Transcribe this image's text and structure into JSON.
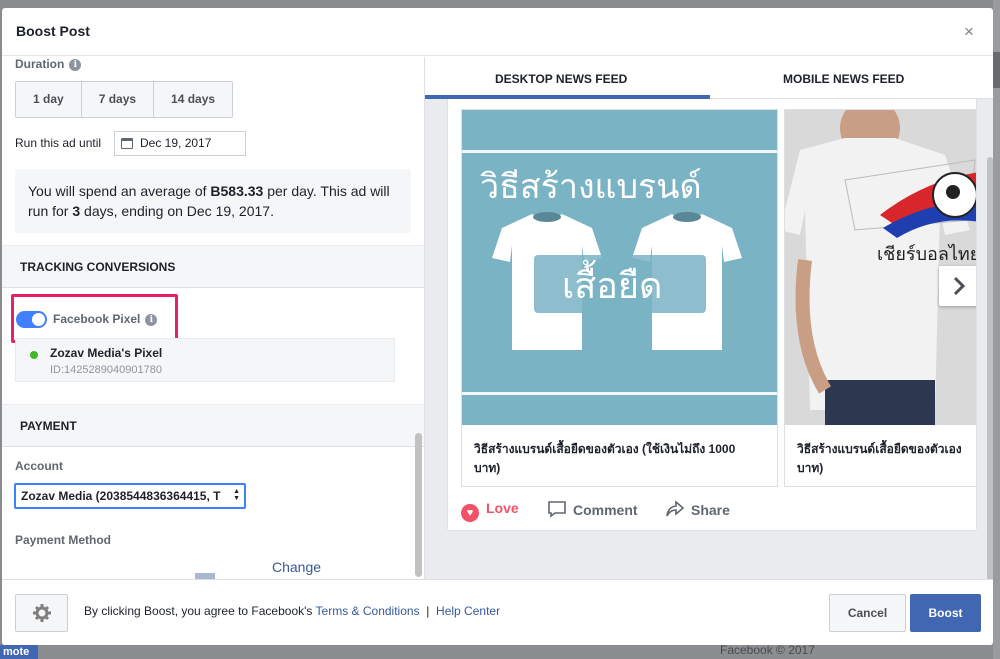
{
  "dialog": {
    "title": "Boost Post",
    "close_glyph": "×"
  },
  "duration": {
    "label": "Duration",
    "options": [
      "1 day",
      "7 days",
      "14 days"
    ],
    "run_until_label": "Run this ad until",
    "end_date": "Dec 19, 2017"
  },
  "spend": {
    "prefix": "You will spend an average of ",
    "amount": "B583.33",
    "mid": " per day. This ad will run for ",
    "days": "3",
    "suffix": " days, ending on Dec 19, 2017."
  },
  "tracking": {
    "header": "TRACKING CONVERSIONS",
    "pixel_label": "Facebook Pixel",
    "pixel_enabled": true,
    "pixel_name": "Zozav Media's Pixel",
    "pixel_id": "ID:1425289040901780"
  },
  "payment": {
    "header": "PAYMENT",
    "account_label": "Account",
    "account_value": "Zozav Media (2038544836364415, T",
    "method_label": "Payment Method",
    "change_link": "Change"
  },
  "preview": {
    "tabs": [
      "DESKTOP NEWS FEED",
      "MOBILE NEWS FEED"
    ],
    "active_tab": "DESKTOP NEWS FEED",
    "cards": [
      {
        "image_text_top": "วิธีสร้างแบรนด์",
        "image_text_mid": "เสื้อยืด",
        "caption_line1": "วิธีสร้างแบรนด์เสื้อยืดของตัวเอง (ใช้เงินไม่ถึง 1000",
        "caption_line2": "บาท)"
      },
      {
        "image_text": "เชียร์บอลไทย",
        "caption_line1": "วิธีสร้างแบรนด์เสื้อยืดของตัวเอง",
        "caption_line2": "บาท)"
      }
    ],
    "actions": [
      "Love",
      "Comment",
      "Share"
    ]
  },
  "footer": {
    "agree_text": "By clicking Boost, you agree to Facebook's ",
    "terms_link": "Terms & Conditions",
    "separator": "|",
    "help_link": "Help Center",
    "cancel_label": "Cancel",
    "boost_label": "Boost"
  },
  "background": {
    "corner_label": "mote",
    "footer_text": "Facebook © 2017"
  },
  "colors": {
    "brand_blue": "#4267b2",
    "toggle_blue": "#4080ff",
    "highlight_pink": "#e8206a",
    "love_red": "#f25268",
    "status_green": "#42b72a",
    "card_teal": "#7ab3c4"
  }
}
